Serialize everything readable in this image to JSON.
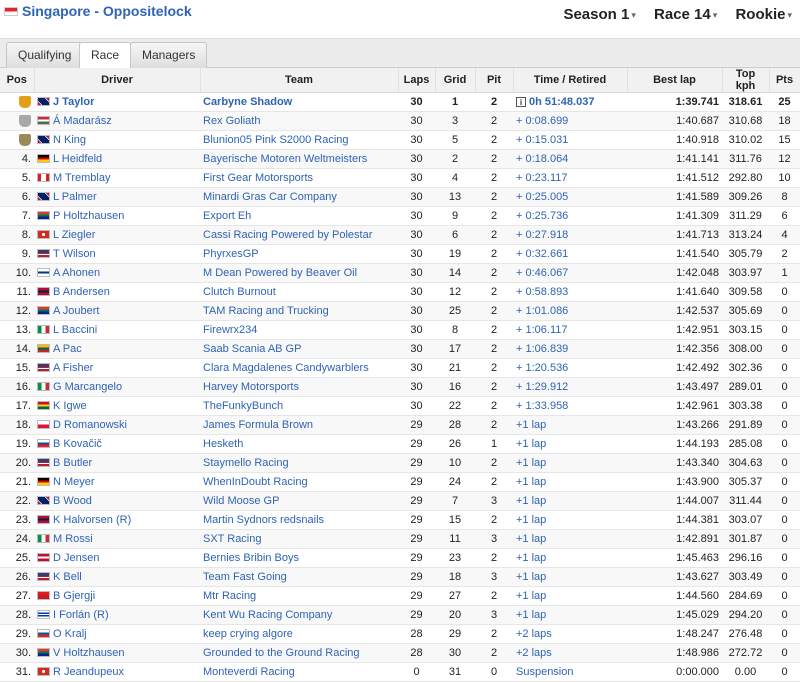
{
  "header": {
    "country": "Singapore",
    "separator": " - ",
    "league": "Oppositelock",
    "season": "Season 1",
    "race": "Race 14",
    "division": "Rookie"
  },
  "tabs": [
    "Qualifying",
    "Race",
    "Managers"
  ],
  "active_tab": "Race",
  "columns": [
    "Pos",
    "Driver",
    "Team",
    "Laps",
    "Grid",
    "Pit",
    "Time / Retired",
    "Best lap",
    "Top kph",
    "Pts"
  ],
  "flag_icons": {
    "gb": "linear-gradient(45deg,#c8102e 18%,#fff 18%,#fff 24%,#012169 24%,#012169 76%,#fff 76%,#fff 82%,#c8102e 82%)",
    "hu": "linear-gradient(#ce2939 33%,#fff 33%,#fff 66%,#477050 66%)",
    "ca": "linear-gradient(90deg,#e31b23 28%,#fff 28%,#fff 72%,#e31b23 72%)",
    "de": "linear-gradient(#000 33%,#dd0000 33%,#dd0000 66%,#ffce00 66%)",
    "za": "linear-gradient(#de3831 33%,#007a4d 33%,#007a4d 66%,#002395 66%)",
    "ch": "radial-gradient(circle,#fff 25%,#d52b1e 26%)",
    "us": "linear-gradient(#3c3b6e 45%,#b22234 45%,#b22234 60%,#fff 60%,#fff 75%,#b22234 75%)",
    "fi": "linear-gradient(#fff 38%,#003580 38%,#003580 62%,#fff 62%)",
    "no": "linear-gradient(#ba0c2f 38%,#00205b 38%,#00205b 62%,#ba0c2f 62%)",
    "it": "linear-gradient(90deg,#009246 33%,#fff 33%,#fff 66%,#ce2b37 66%)",
    "lt": "linear-gradient(#fdb913 33%,#006a44 33%,#006a44 66%,#c1272d 66%)",
    "gh": "linear-gradient(#ce1126 33%,#fcd116 33%,#fcd116 66%,#006b3f 66%)",
    "pl": "linear-gradient(#fff 50%,#dc143c 50%)",
    "sk": "linear-gradient(#fff 33%,#0b4ea2 33%,#0b4ea2 66%,#ee1c25 66%)",
    "dk": "linear-gradient(#c60c30 38%,#fff 38%,#fff 62%,#c60c30 62%)",
    "al": "linear-gradient(#e41e20,#c4161c)",
    "uy": "linear-gradient(#fff 20%,#0038a8 20%,#0038a8 40%,#fff 40%,#fff 60%,#0038a8 60%,#0038a8 80%,#fff 80%)",
    "si": "linear-gradient(#fff 33%,#005da4 33%,#005da4 66%,#ed1c24 66%)"
  },
  "trophy_colors": {
    "gold": "#e0a019",
    "silver": "#a8a8a8",
    "bronze": "#9a8a5a"
  },
  "results": [
    {
      "pos": "1.",
      "trophy": "gold",
      "flag": "gb",
      "driver": "J Taylor",
      "team": "Carbyne Shadow",
      "laps": "30",
      "grid": "1",
      "pit": "2",
      "time": "0h 51:48.037",
      "info": true,
      "best": "1:39.741",
      "kph": "318.61",
      "pts": "25"
    },
    {
      "pos": "2.",
      "trophy": "silver",
      "flag": "hu",
      "driver": "Á Madarász",
      "team": "Rex Goliath",
      "laps": "30",
      "grid": "3",
      "pit": "2",
      "time": "+ 0:08.699",
      "best": "1:40.687",
      "kph": "310.68",
      "pts": "18"
    },
    {
      "pos": "3.",
      "trophy": "bronze",
      "flag": "gb",
      "driver": "N King",
      "team": "Blunion05 Pink S2000 Racing",
      "laps": "30",
      "grid": "5",
      "pit": "2",
      "time": "+ 0:15.031",
      "best": "1:40.918",
      "kph": "310.02",
      "pts": "15"
    },
    {
      "pos": "4.",
      "flag": "de",
      "driver": "L Heidfeld",
      "team": "Bayerische Motoren Weltmeisters",
      "laps": "30",
      "grid": "2",
      "pit": "2",
      "time": "+ 0:18.064",
      "best": "1:41.141",
      "kph": "311.76",
      "pts": "12"
    },
    {
      "pos": "5.",
      "flag": "ca",
      "driver": "M Tremblay",
      "team": "First Gear Motorsports",
      "laps": "30",
      "grid": "4",
      "pit": "2",
      "time": "+ 0:23.117",
      "best": "1:41.512",
      "kph": "292.80",
      "pts": "10"
    },
    {
      "pos": "6.",
      "flag": "gb",
      "driver": "L Palmer",
      "team": "Minardi Gras Car Company",
      "laps": "30",
      "grid": "13",
      "pit": "2",
      "time": "+ 0:25.005",
      "best": "1:41.589",
      "kph": "309.26",
      "pts": "8"
    },
    {
      "pos": "7.",
      "flag": "za",
      "driver": "P Holtzhausen",
      "team": "Export Eh",
      "laps": "30",
      "grid": "9",
      "pit": "2",
      "time": "+ 0:25.736",
      "best": "1:41.309",
      "kph": "311.29",
      "pts": "6"
    },
    {
      "pos": "8.",
      "flag": "ch",
      "driver": "L Ziegler",
      "team": "Cassi Racing Powered by Polestar",
      "laps": "30",
      "grid": "6",
      "pit": "2",
      "time": "+ 0:27.918",
      "best": "1:41.713",
      "kph": "313.24",
      "pts": "4"
    },
    {
      "pos": "9.",
      "flag": "us",
      "driver": "T Wilson",
      "team": "PhyrxesGP",
      "laps": "30",
      "grid": "19",
      "pit": "2",
      "time": "+ 0:32.661",
      "best": "1:41.540",
      "kph": "305.79",
      "pts": "2"
    },
    {
      "pos": "10.",
      "flag": "fi",
      "driver": "A Ahonen",
      "team": "M Dean Powered by Beaver Oil",
      "laps": "30",
      "grid": "14",
      "pit": "2",
      "time": "+ 0:46.067",
      "best": "1:42.048",
      "kph": "303.97",
      "pts": "1"
    },
    {
      "pos": "11.",
      "flag": "no",
      "driver": "B Andersen",
      "team": "Clutch Burnout",
      "laps": "30",
      "grid": "12",
      "pit": "2",
      "time": "+ 0:58.893",
      "best": "1:41.640",
      "kph": "309.58",
      "pts": "0"
    },
    {
      "pos": "12.",
      "flag": "za",
      "driver": "A Joubert",
      "team": "TAM Racing and Trucking",
      "laps": "30",
      "grid": "25",
      "pit": "2",
      "time": "+ 1:01.086",
      "best": "1:42.537",
      "kph": "305.69",
      "pts": "0"
    },
    {
      "pos": "13.",
      "flag": "it",
      "driver": "L Baccini",
      "team": "Firewrx234",
      "laps": "30",
      "grid": "8",
      "pit": "2",
      "time": "+ 1:06.117",
      "best": "1:42.951",
      "kph": "303.15",
      "pts": "0"
    },
    {
      "pos": "14.",
      "flag": "lt",
      "driver": "A Pac",
      "team": "Saab Scania AB GP",
      "laps": "30",
      "grid": "17",
      "pit": "2",
      "time": "+ 1:06.839",
      "best": "1:42.356",
      "kph": "308.00",
      "pts": "0"
    },
    {
      "pos": "15.",
      "flag": "us",
      "driver": "A Fisher",
      "team": "Clara Magdalenes Candywarblers",
      "laps": "30",
      "grid": "21",
      "pit": "2",
      "time": "+ 1:20.536",
      "best": "1:42.492",
      "kph": "302.36",
      "pts": "0"
    },
    {
      "pos": "16.",
      "flag": "it",
      "driver": "G Marcangelo",
      "team": "Harvey Motorsports",
      "laps": "30",
      "grid": "16",
      "pit": "2",
      "time": "+ 1:29.912",
      "best": "1:43.497",
      "kph": "289.01",
      "pts": "0"
    },
    {
      "pos": "17.",
      "flag": "gh",
      "driver": "K Igwe",
      "team": "TheFunkyBunch",
      "laps": "30",
      "grid": "22",
      "pit": "2",
      "time": "+ 1:33.958",
      "best": "1:42.961",
      "kph": "303.38",
      "pts": "0"
    },
    {
      "pos": "18.",
      "flag": "pl",
      "driver": "D Romanowski",
      "team": "James Formula Brown",
      "laps": "29",
      "grid": "28",
      "pit": "2",
      "time": "+1 lap",
      "best": "1:43.266",
      "kph": "291.89",
      "pts": "0"
    },
    {
      "pos": "19.",
      "flag": "sk",
      "driver": "B Kovačič",
      "team": "Hesketh",
      "laps": "29",
      "grid": "26",
      "pit": "1",
      "time": "+1 lap",
      "best": "1:44.193",
      "kph": "285.08",
      "pts": "0"
    },
    {
      "pos": "20.",
      "flag": "us",
      "driver": "B Butler",
      "team": "Staymello Racing",
      "laps": "29",
      "grid": "10",
      "pit": "2",
      "time": "+1 lap",
      "best": "1:43.340",
      "kph": "304.63",
      "pts": "0"
    },
    {
      "pos": "21.",
      "flag": "de",
      "driver": "N Meyer",
      "team": "WhenInDoubt Racing",
      "laps": "29",
      "grid": "24",
      "pit": "2",
      "time": "+1 lap",
      "best": "1:43.900",
      "kph": "305.37",
      "pts": "0"
    },
    {
      "pos": "22.",
      "flag": "gb",
      "driver": "B Wood",
      "team": "Wild Moose GP",
      "laps": "29",
      "grid": "7",
      "pit": "3",
      "time": "+1 lap",
      "best": "1:44.007",
      "kph": "311.44",
      "pts": "0"
    },
    {
      "pos": "23.",
      "flag": "no",
      "driver": "K Halvorsen (R)",
      "team": "Martin Sydnors redsnails",
      "laps": "29",
      "grid": "15",
      "pit": "2",
      "time": "+1 lap",
      "best": "1:44.381",
      "kph": "303.07",
      "pts": "0"
    },
    {
      "pos": "24.",
      "flag": "it",
      "driver": "M Rossi",
      "team": "SXT Racing",
      "laps": "29",
      "grid": "11",
      "pit": "3",
      "time": "+1 lap",
      "best": "1:42.891",
      "kph": "301.87",
      "pts": "0"
    },
    {
      "pos": "25.",
      "flag": "dk",
      "driver": "D Jensen",
      "team": "Bernies Bribin Boys",
      "laps": "29",
      "grid": "23",
      "pit": "2",
      "time": "+1 lap",
      "best": "1:45.463",
      "kph": "296.16",
      "pts": "0"
    },
    {
      "pos": "26.",
      "flag": "us",
      "driver": "K Bell",
      "team": "Team Fast Going",
      "laps": "29",
      "grid": "18",
      "pit": "3",
      "time": "+1 lap",
      "best": "1:43.627",
      "kph": "303.49",
      "pts": "0"
    },
    {
      "pos": "27.",
      "flag": "al",
      "driver": "B Gjergji",
      "team": "Mtr Racing",
      "laps": "29",
      "grid": "27",
      "pit": "2",
      "time": "+1 lap",
      "best": "1:44.560",
      "kph": "284.69",
      "pts": "0"
    },
    {
      "pos": "28.",
      "flag": "uy",
      "driver": "I Forlán (R)",
      "team": "Kent Wu Racing Company",
      "laps": "29",
      "grid": "20",
      "pit": "3",
      "time": "+1 lap",
      "best": "1:45.029",
      "kph": "294.20",
      "pts": "0"
    },
    {
      "pos": "29.",
      "flag": "si",
      "driver": "O Kralj",
      "team": "keep crying algore",
      "laps": "28",
      "grid": "29",
      "pit": "2",
      "time": "+2 laps",
      "best": "1:48.247",
      "kph": "276.48",
      "pts": "0"
    },
    {
      "pos": "30.",
      "flag": "za",
      "driver": "V Holtzhausen",
      "team": "Grounded to the Ground Racing",
      "laps": "28",
      "grid": "30",
      "pit": "2",
      "time": "+2 laps",
      "best": "1:48.986",
      "kph": "272.72",
      "pts": "0"
    },
    {
      "pos": "31.",
      "flag": "ch",
      "driver": "R Jeandupeux",
      "team": "Monteverdi Racing",
      "laps": "0",
      "grid": "31",
      "pit": "0",
      "time": "Suspension",
      "best": "0:00.000",
      "kph": "0.00",
      "pts": "0"
    }
  ]
}
